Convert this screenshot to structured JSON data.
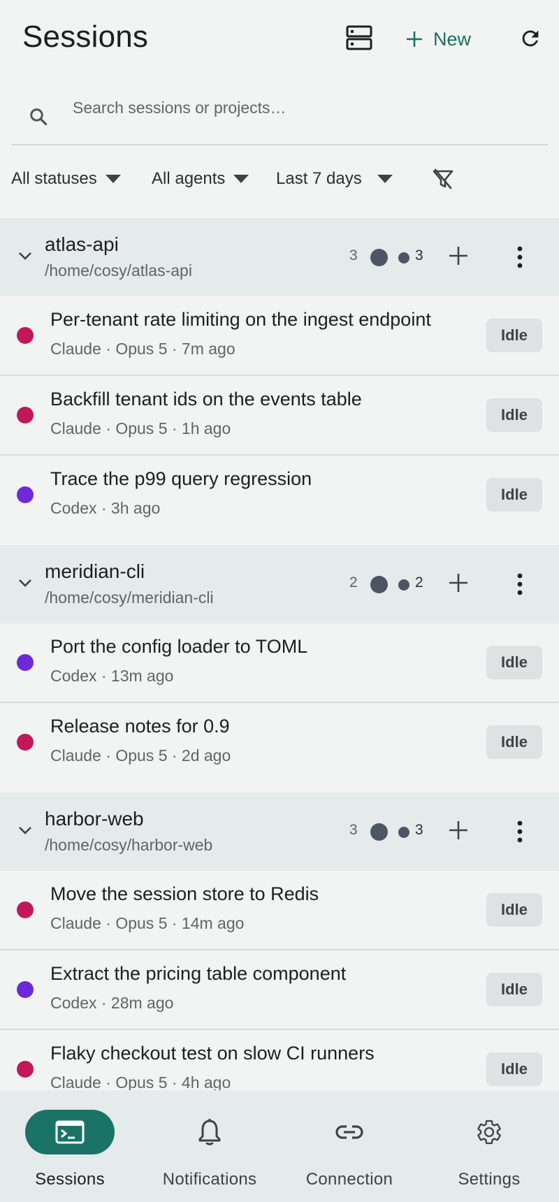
{
  "header": {
    "title": "Sessions",
    "new_label": "New"
  },
  "search": {
    "placeholder": "Search sessions or projects…"
  },
  "filters": {
    "status": "All statuses",
    "agent": "All agents",
    "range": "Last 7 days"
  },
  "colors": {
    "accent": "#1b7368",
    "claude_dot": "#c2185b",
    "codex_dot": "#6d28d9",
    "group_bg": "#e5eaea"
  },
  "groups": [
    {
      "name": "atlas-api",
      "path": "/home/cosy/atlas-api",
      "count": "3",
      "idle_count": "3",
      "sessions": [
        {
          "title": "Per-tenant rate limiting on the ingest endpoint",
          "meta": "Claude · Opus 5 · 7m ago",
          "agent": "claude",
          "status": "Idle"
        },
        {
          "title": "Backfill tenant ids on the events table",
          "meta": "Claude · Opus 5 · 1h ago",
          "agent": "claude",
          "status": "Idle"
        },
        {
          "title": "Trace the p99 query regression",
          "meta": "Codex · 3h ago",
          "agent": "codex",
          "status": "Idle"
        }
      ]
    },
    {
      "name": "meridian-cli",
      "path": "/home/cosy/meridian-cli",
      "count": "2",
      "idle_count": "2",
      "sessions": [
        {
          "title": "Port the config loader to TOML",
          "meta": "Codex · 13m ago",
          "agent": "codex",
          "status": "Idle"
        },
        {
          "title": "Release notes for 0.9",
          "meta": "Claude · Opus 5 · 2d ago",
          "agent": "claude",
          "status": "Idle"
        }
      ]
    },
    {
      "name": "harbor-web",
      "path": "/home/cosy/harbor-web",
      "count": "3",
      "idle_count": "3",
      "sessions": [
        {
          "title": "Move the session store to Redis",
          "meta": "Claude · Opus 5 · 14m ago",
          "agent": "claude",
          "status": "Idle"
        },
        {
          "title": "Extract the pricing table component",
          "meta": "Codex · 28m ago",
          "agent": "codex",
          "status": "Idle"
        },
        {
          "title": "Flaky checkout test on slow CI runners",
          "meta": "Claude · Opus 5 · 4h ago",
          "agent": "claude",
          "status": "Idle"
        }
      ]
    }
  ],
  "nav": [
    {
      "label": "Sessions",
      "icon": "terminal-icon",
      "active": true
    },
    {
      "label": "Notifications",
      "icon": "bell-icon",
      "active": false
    },
    {
      "label": "Connection",
      "icon": "link-icon",
      "active": false
    },
    {
      "label": "Settings",
      "icon": "gear-icon",
      "active": false
    }
  ]
}
